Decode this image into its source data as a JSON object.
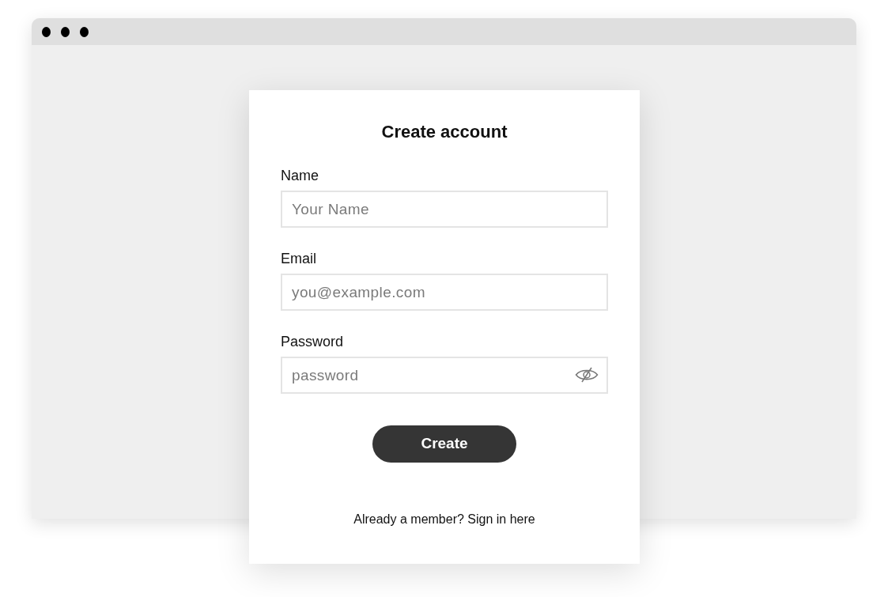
{
  "form": {
    "title": "Create account",
    "fields": [
      {
        "kind": "text",
        "label": "Name",
        "placeholder": "Your Name"
      },
      {
        "kind": "email",
        "label": "Email",
        "placeholder": "you@example.com"
      },
      {
        "kind": "password",
        "label": "Password",
        "placeholder": "password"
      }
    ],
    "submit": "Create",
    "footer": {
      "text": "Already a member?",
      "link": "Sign in here"
    }
  }
}
